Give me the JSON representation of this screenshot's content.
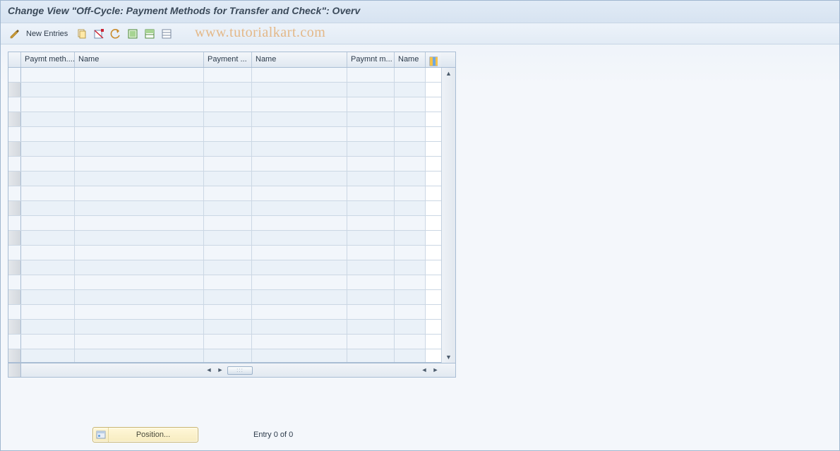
{
  "title": "Change View \"Off-Cycle: Payment Methods for Transfer and Check\": Overv",
  "toolbar": {
    "new_entries_label": "New Entries"
  },
  "watermark": "www.tutorialkart.com",
  "table": {
    "columns": [
      "Paymt meth....",
      "Name",
      "Payment ...",
      "Name",
      "Paymnt m...",
      "Name"
    ],
    "row_count": 20
  },
  "footer": {
    "position_label": "Position...",
    "entry_text": "Entry 0 of 0"
  }
}
